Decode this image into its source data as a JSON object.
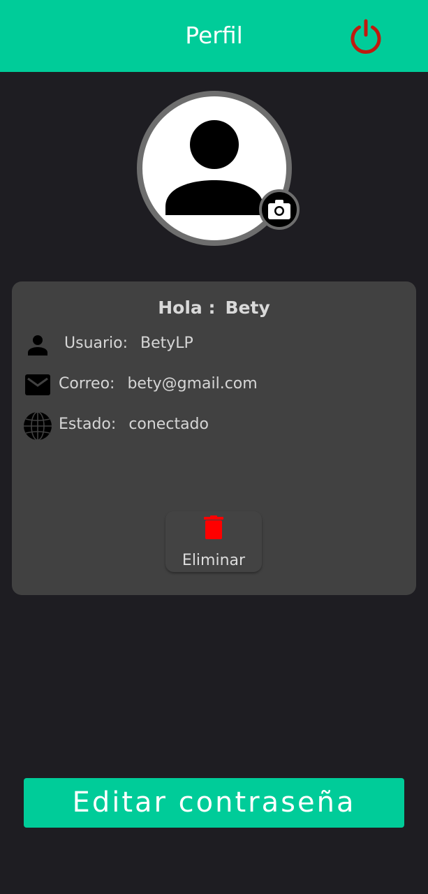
{
  "header": {
    "title": "Perfil",
    "logout_icon": "power-icon",
    "logout_color": "#c01a0f",
    "background": "#00cc99"
  },
  "profile": {
    "avatar_icon": "person-icon",
    "camera_icon": "camera-icon"
  },
  "card": {
    "greeting_label": "Hola :",
    "greeting_name": "Bety",
    "user": {
      "icon": "person-icon",
      "label": "Usuario:",
      "value": "BetyLP"
    },
    "email": {
      "icon": "mail-icon",
      "label": "Correo:",
      "value": "bety@gmail.com"
    },
    "status": {
      "icon": "globe-icon",
      "label": "Estado:",
      "value": "conectado"
    },
    "delete_button": {
      "icon": "trash-icon",
      "icon_color": "#ff0000",
      "label": "Eliminar"
    }
  },
  "edit_password_button": {
    "label": "Editar contraseña"
  }
}
